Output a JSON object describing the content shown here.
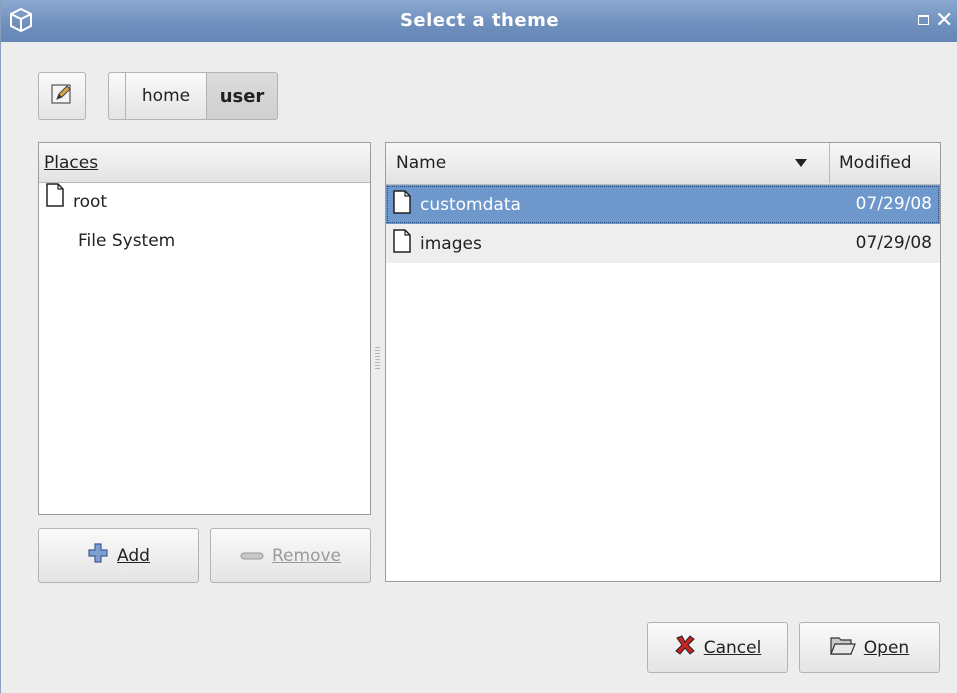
{
  "window": {
    "title": "Select a theme"
  },
  "breadcrumb": {
    "segments": [
      "home",
      "user"
    ],
    "active": "user"
  },
  "places": {
    "header": "Places",
    "items": [
      {
        "label": "root",
        "icon": "file-icon"
      },
      {
        "label": "File System",
        "icon": ""
      }
    ],
    "add_label": "Add",
    "remove_label": "Remove"
  },
  "files": {
    "columns": {
      "name": "Name",
      "modified": "Modified"
    },
    "rows": [
      {
        "name": "customdata",
        "modified": "07/29/08",
        "selected": true
      },
      {
        "name": "images",
        "modified": "07/29/08",
        "selected": false
      }
    ]
  },
  "actions": {
    "cancel_label": "Cancel",
    "open_label": "Open"
  },
  "colors": {
    "titlebar": "#6e8fbd",
    "selection": "#6e97cc",
    "cancel_x": "#cc2222"
  }
}
